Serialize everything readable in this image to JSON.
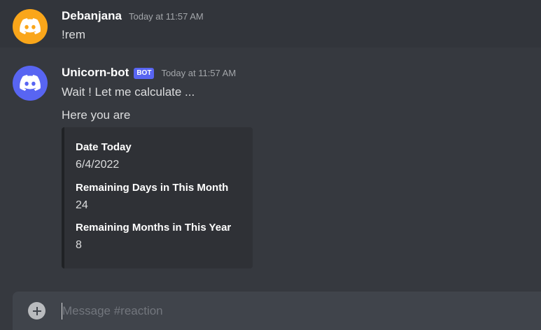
{
  "messages": [
    {
      "author": "Debanjana",
      "timestamp": "Today at 11:57 AM",
      "avatar_icon": "discord-logo-icon",
      "avatar_color": "#faa61a",
      "text": "!rem"
    },
    {
      "author": "Unicorn-bot",
      "bot_tag": "BOT",
      "timestamp": "Today at 11:57 AM",
      "avatar_icon": "discord-logo-icon",
      "avatar_color": "#5865f2",
      "lines": [
        "Wait ! Let me calculate ...",
        "Here you are"
      ],
      "embed": {
        "fields": [
          {
            "name": "Date Today",
            "value": "6/4/2022"
          },
          {
            "name": "Remaining Days in This Month",
            "value": "24"
          },
          {
            "name": "Remaining Months in This Year",
            "value": "8"
          }
        ]
      }
    }
  ],
  "composer": {
    "placeholder": "Message #reaction",
    "add_icon": "plus-circle-icon"
  },
  "colors": {
    "background": "#36393f",
    "highlight_row": "#32353b",
    "embed_bg": "#2f3136",
    "bot_tag": "#5865f2",
    "composer_bg": "#40444b"
  }
}
